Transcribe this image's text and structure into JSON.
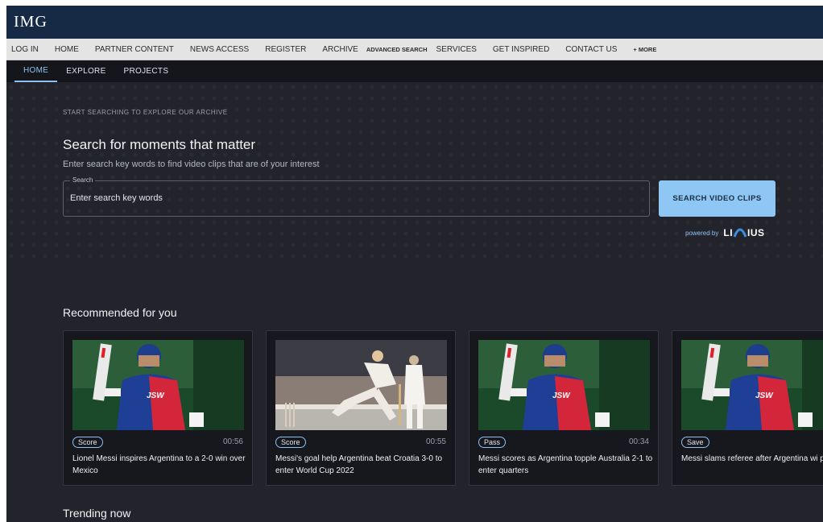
{
  "brand": {
    "logo_text": "IMG"
  },
  "top_nav": [
    {
      "label": "LOG IN"
    },
    {
      "label": "HOME"
    },
    {
      "label": "PARTNER CONTENT"
    },
    {
      "label": "NEWS ACCESS"
    },
    {
      "label": "REGISTER"
    },
    {
      "label": "ARCHIVE"
    },
    {
      "label": "ADVANCED SEARCH"
    },
    {
      "label": "SERVICES"
    },
    {
      "label": "GET INSPIRED"
    },
    {
      "label": "CONTACT US"
    },
    {
      "label": "+ MORE"
    }
  ],
  "sub_nav": [
    {
      "label": "HOME",
      "active": true
    },
    {
      "label": "EXPLORE",
      "active": false
    },
    {
      "label": "PROJECTS",
      "active": false
    }
  ],
  "hero": {
    "eyebrow": "START SEARCHING TO EXPLORE OUR ARCHIVE",
    "title": "Search for moments that matter",
    "subtitle": "Enter search key words to find video clips that are of your interest",
    "search_legend": "Search",
    "search_placeholder": "Enter search key words",
    "search_value": "",
    "search_button": "SEARCH VIDEO CLIPS",
    "powered_label": "powered by",
    "powered_brand": "LINIUS"
  },
  "sections": {
    "recommended": "Recommended for you",
    "trending": "Trending now"
  },
  "cards": [
    {
      "tag": "Score",
      "duration": "00:56",
      "title": "Lionel Messi inspires Argentina to a 2-0 win over Mexico",
      "thumb": "cricket-batter"
    },
    {
      "tag": "Score",
      "duration": "00:55",
      "title": "Messi's goal help Argentina beat Croatia 3-0 to enter World Cup 2022",
      "thumb": "cricket-bowler"
    },
    {
      "tag": "Pass",
      "duration": "00:34",
      "title": "Messi scores as Argentina topple Australia 2-1 to enter quarters",
      "thumb": "cricket-batter"
    },
    {
      "tag": "Save",
      "duration": "",
      "title": "Messi slams referee after Argentina wi penalties",
      "thumb": "cricket-batter"
    }
  ],
  "colors": {
    "brand_bar": "#162a45",
    "accent": "#8ec0f2",
    "page_bg": "#23242b",
    "button_bg": "#8fc7f4"
  }
}
